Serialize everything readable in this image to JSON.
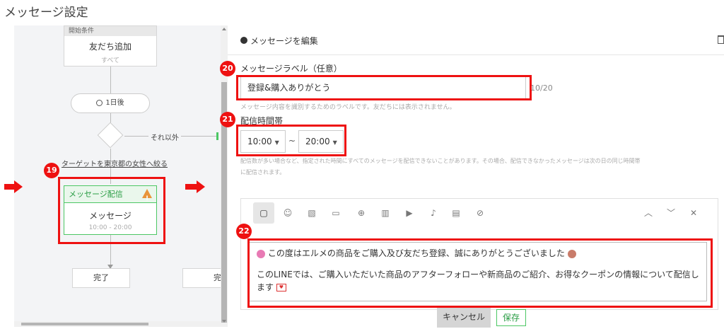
{
  "page": {
    "title": "メッセージ設定"
  },
  "flow": {
    "start_node": {
      "header": "開始条件",
      "title": "友だち追加",
      "sub": "すべて"
    },
    "wait_pill": {
      "icon": "clock-icon",
      "label": "1日後"
    },
    "branch": {
      "else_label": "それ以外",
      "target_label": "ターゲットを東京都の女性へ絞る"
    },
    "message_node": {
      "header": "メッセージ配信",
      "warning_icon": "warning-icon",
      "title": "メッセージ",
      "time": "10:00 - 20:00"
    },
    "end_nodes": [
      {
        "label": "完了"
      },
      {
        "label": "完"
      }
    ]
  },
  "annotations": {
    "badges": [
      "19",
      "20",
      "21",
      "22"
    ],
    "accent_color": "#ee1111"
  },
  "editor": {
    "header_label": "メッセージを編集",
    "label_field": {
      "label": "メッセージラベル（任意）",
      "value": "登録&購入ありがとう",
      "counter": "10/20",
      "hint": "メッセージ内容を識別するためのラベルです。友だちには表示されません。"
    },
    "time_field": {
      "label": "配信時間帯",
      "start": "10:00",
      "separator": "~",
      "end": "20:00",
      "note_line1": "配信数が多い場合など、指定された時間にすべてのメッセージを配信できないことがあります。その場合、配信できなかったメッセージは次の日の同じ時間帯",
      "note_line2": "に配信されます。"
    },
    "toolbar_icons": [
      "speech-bubble-icon",
      "smiley-icon",
      "image-icon",
      "card-icon",
      "question-icon",
      "carousel-icon",
      "video-icon",
      "microphone-icon",
      "clipboard-icon",
      "compass-icon"
    ],
    "message_line1": "この度はエルメの商品をご購入及び友だち登録、誠にありがとうございました",
    "message_line2": "このLINEでは、ご購入いただいた商品のアフターフォローや新商品のご紹介、お得なクーポンの情報について配信し",
    "message_line3": "ます",
    "cancel_label": "キャンセル",
    "save_label": "保存"
  }
}
